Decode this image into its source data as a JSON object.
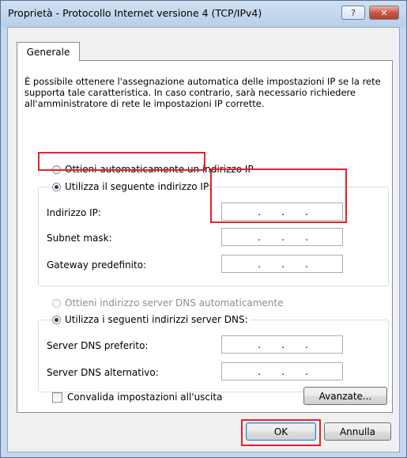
{
  "window": {
    "title": "Proprietà - Protocollo Internet versione 4 (TCP/IPv4)",
    "help_label": "?",
    "close_label": "✕"
  },
  "tabs": [
    {
      "label": "Generale"
    }
  ],
  "description": "È possibile ottenere l'assegnazione automatica delle impostazioni IP se la rete supporta tale caratteristica. In caso contrario, sarà necessario richiedere all'amministratore di rete le impostazioni IP corrette.",
  "ip_section": {
    "auto_label": "Ottieni automaticamente un indirizzo IP",
    "manual_label": "Utilizza il seguente indirizzo IP:",
    "fields": [
      {
        "label": "Indirizzo IP:",
        "dots": "."
      },
      {
        "label": "Subnet mask:",
        "dots": "."
      },
      {
        "label": "Gateway predefinito:",
        "dots": "."
      }
    ]
  },
  "dns_section": {
    "auto_label": "Ottieni indirizzo server DNS automaticamente",
    "manual_label": "Utilizza i seguenti indirizzi server DNS:",
    "fields": [
      {
        "label": "Server DNS preferito:"
      },
      {
        "label": "Server DNS alternativo:"
      }
    ]
  },
  "validate_label": "Convalida impostazioni all'uscita",
  "advanced_label": "Avanzate...",
  "ok_label": "OK",
  "cancel_label": "Annulla",
  "colors": {
    "highlight": "#e8202a"
  }
}
